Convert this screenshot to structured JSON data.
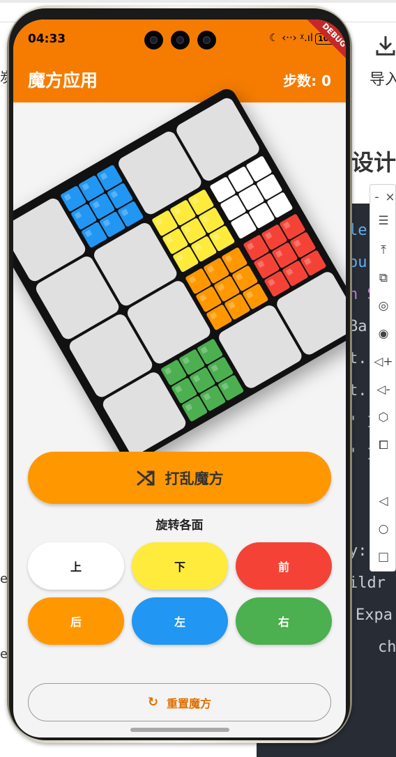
{
  "background": {
    "import_label": "导入",
    "heading": "设计",
    "left_edge_text": "炭",
    "left_text_lines": [
      "ec",
      "ec"
    ],
    "code_lines": [
      "le",
      "ou",
      "n S",
      "Ba",
      "t.",
      "t.",
      "' I",
      "' I",
      "y:",
      "ildr",
      "Expa",
      "ch"
    ]
  },
  "emulator_toolbar": {
    "buttons": [
      "-",
      "×",
      "☰",
      "⤒",
      "⧉",
      "◎",
      "◉",
      "◁+",
      "◁-",
      "⬡",
      "⧠",
      "◁",
      "○",
      "□"
    ]
  },
  "status_bar": {
    "time": "04:33",
    "icons": "☾ ‹··› ᵡ.ıl",
    "battery": "100"
  },
  "debug_banner": "DEBUG",
  "app_bar": {
    "title": "魔方应用",
    "steps_label": "步数: 0"
  },
  "cube_net": {
    "colors": {
      "empty": "#e0e0e0",
      "blue": "#2196f3",
      "white": "#ffffff",
      "yellow": "#ffeb3b",
      "red": "#f44336",
      "orange": "#ff9800",
      "green": "#4caf50"
    },
    "rows": [
      [
        "empty",
        "blue",
        "empty",
        "empty"
      ],
      [
        "empty",
        "empty",
        "yellow",
        "white"
      ],
      [
        "empty",
        "empty",
        "orange",
        "red"
      ],
      [
        "empty",
        "green",
        "empty",
        "empty"
      ]
    ]
  },
  "actions": {
    "scramble_label": "打乱魔方",
    "rotate_title": "旋转各面",
    "faces": [
      {
        "label": "上",
        "color": "#ffffff",
        "text_color": "#111111"
      },
      {
        "label": "下",
        "color": "#ffeb3b",
        "text_color": "#111111"
      },
      {
        "label": "前",
        "color": "#f44336",
        "text_color": "#ffffff"
      },
      {
        "label": "后",
        "color": "#ff9800",
        "text_color": "#ffffff"
      },
      {
        "label": "左",
        "color": "#2196f3",
        "text_color": "#ffffff"
      },
      {
        "label": "右",
        "color": "#4caf50",
        "text_color": "#ffffff"
      }
    ],
    "reset_label": "重置魔方"
  },
  "theme": {
    "app_bar": "#f57c00",
    "accent": "#ff9800",
    "reset_text": "#e07000"
  }
}
